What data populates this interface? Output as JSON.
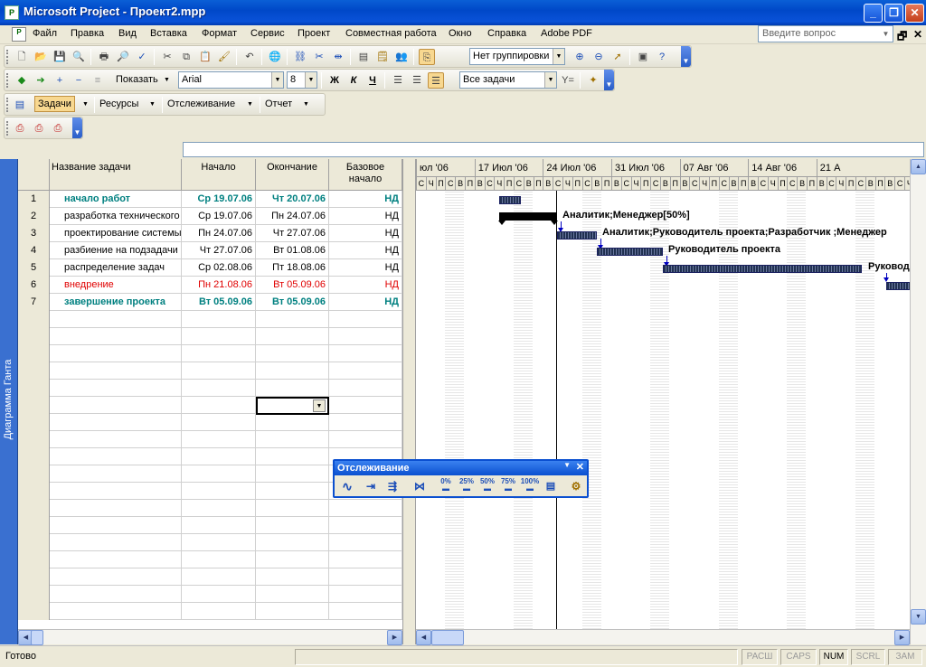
{
  "window": {
    "title": "Microsoft Project - Проект2.mpp"
  },
  "menu": {
    "items": [
      "Файл",
      "Правка",
      "Вид",
      "Вставка",
      "Формат",
      "Сервис",
      "Проект",
      "Совместная работа",
      "Окно",
      "Справка",
      "Adobe PDF"
    ],
    "question_placeholder": "Введите вопрос"
  },
  "toolbars": {
    "grouping": "Нет группировки",
    "show": "Показать",
    "font": "Arial",
    "font_size": "8",
    "filter": "Все задачи",
    "bold": "Ж",
    "italic": "К",
    "underline": "Ч",
    "guide": {
      "tasks": "Задачи",
      "resources": "Ресурсы",
      "tracking": "Отслеживание",
      "report": "Отчет"
    }
  },
  "view_bar": {
    "label": "Диаграмма Ганта"
  },
  "table": {
    "columns": {
      "name": "Название задачи",
      "start": "Начало",
      "finish": "Окончание",
      "baseline": "Базовое начало"
    },
    "rows": [
      {
        "id": "1",
        "name": "начало работ",
        "start": "Ср 19.07.06",
        "finish": "Чт 20.07.06",
        "baseline": "НД",
        "style": "summary"
      },
      {
        "id": "2",
        "name": "разработка технического",
        "start": "Ср 19.07.06",
        "finish": "Пн 24.07.06",
        "baseline": "НД",
        "style": "normal"
      },
      {
        "id": "3",
        "name": "проектирование системы",
        "start": "Пн 24.07.06",
        "finish": "Чт 27.07.06",
        "baseline": "НД",
        "style": "normal"
      },
      {
        "id": "4",
        "name": "разбиение на подзадачи",
        "start": "Чт 27.07.06",
        "finish": "Вт 01.08.06",
        "baseline": "НД",
        "style": "normal"
      },
      {
        "id": "5",
        "name": "распределение задач",
        "start": "Ср 02.08.06",
        "finish": "Пт 18.08.06",
        "baseline": "НД",
        "style": "normal"
      },
      {
        "id": "6",
        "name": "внедрение",
        "start": "Пн 21.08.06",
        "finish": "Вт 05.09.06",
        "baseline": "НД",
        "style": "critical"
      },
      {
        "id": "7",
        "name": "завершение проекта",
        "start": "Вт 05.09.06",
        "finish": "Вт 05.09.06",
        "baseline": "НД",
        "style": "summary"
      }
    ]
  },
  "timescale": {
    "weeks": [
      "юл '06",
      "17 Июл '06",
      "24 Июл '06",
      "31 Июл '06",
      "07 Авг '06",
      "14 Авг '06",
      "21 А"
    ],
    "day_letters": [
      "С",
      "Ч",
      "П",
      "С",
      "В",
      "П",
      "В"
    ]
  },
  "bar_labels": [
    "Аналитик;Менеджер[50%]",
    "Аналитик;Руководитель проекта;Разработчик ;Менеджер",
    "Руководитель проекта",
    "Руковод"
  ],
  "tracking_toolbar": {
    "title": "Отслеживание",
    "percents": [
      "0%",
      "25%",
      "50%",
      "75%",
      "100%"
    ]
  },
  "status": {
    "text": "Готово",
    "panes": [
      "РАСШ",
      "CAPS",
      "NUM",
      "SCRL",
      "ЗАМ"
    ],
    "active": "NUM"
  }
}
